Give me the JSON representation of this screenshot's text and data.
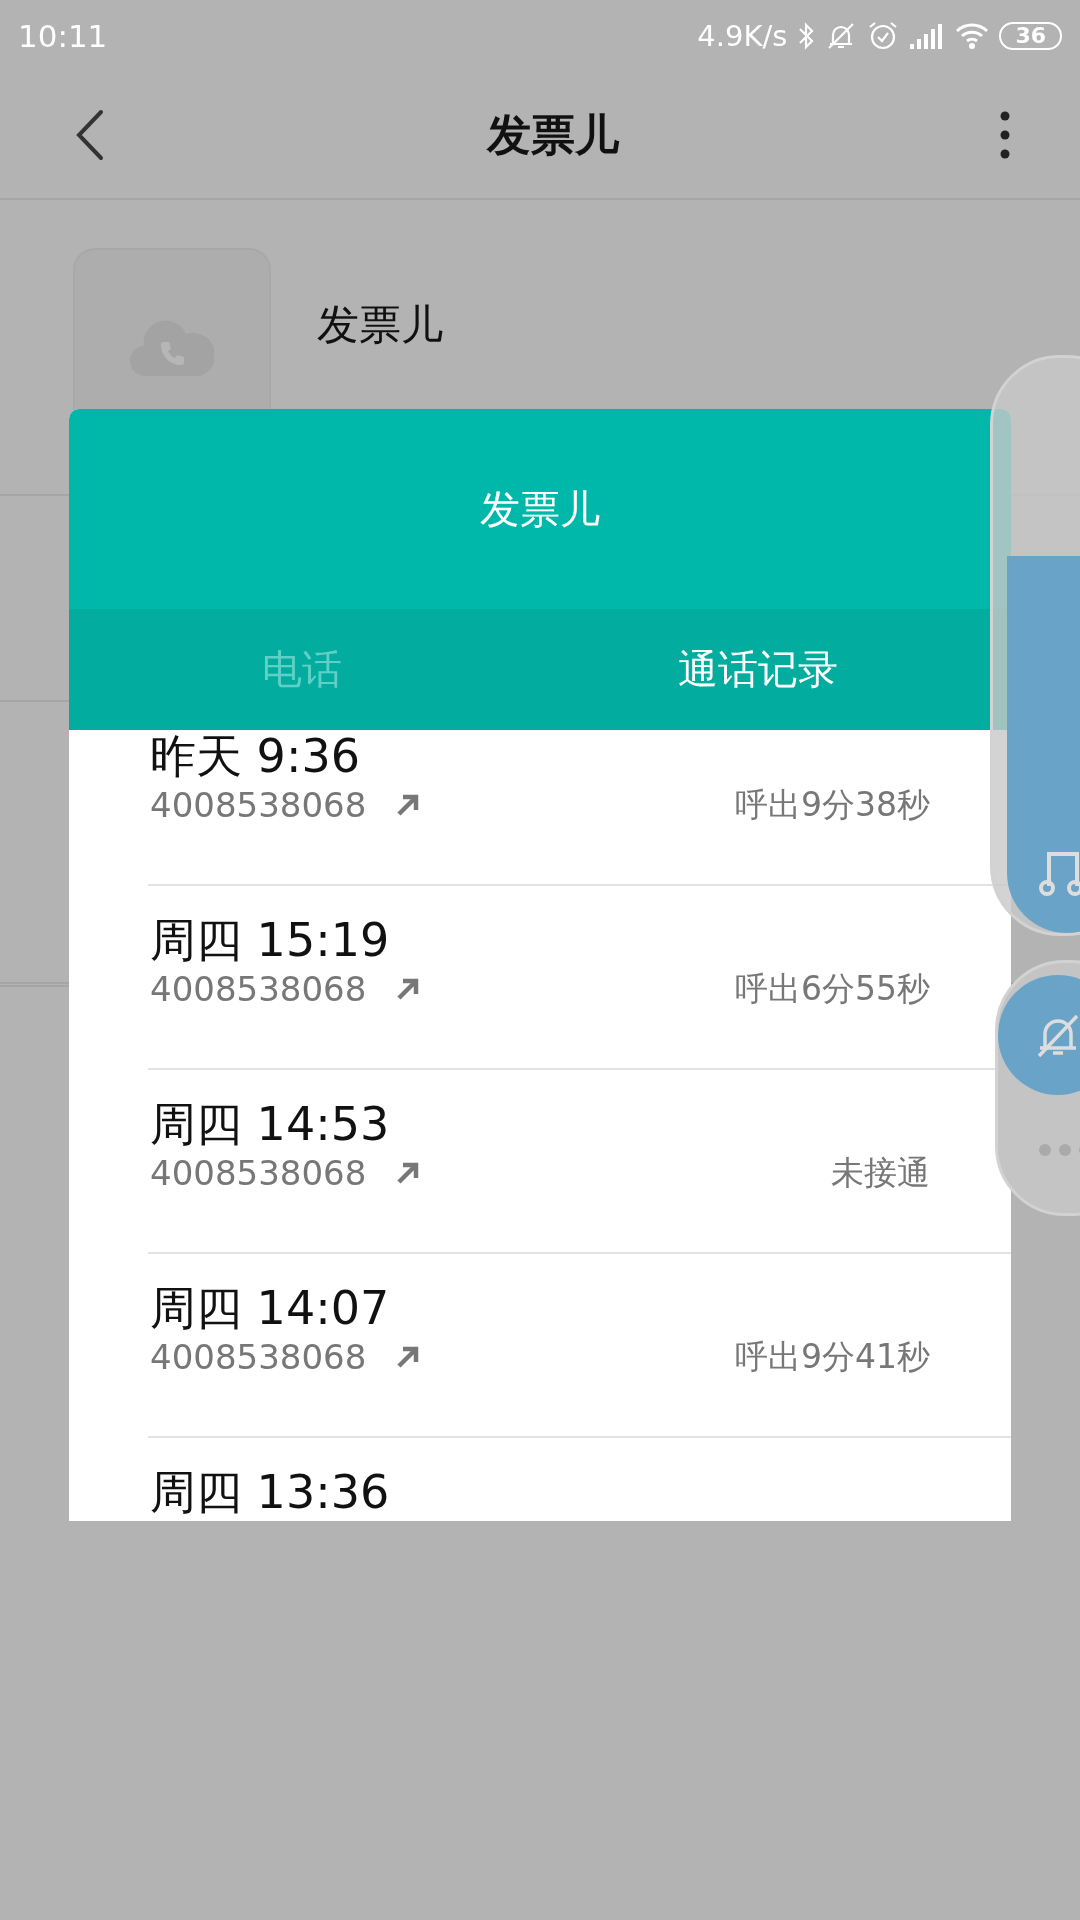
{
  "status_bar": {
    "time": "10:11",
    "net_speed": "4.9K/s",
    "battery": "36"
  },
  "app_bar": {
    "title": "发票儿"
  },
  "contact": {
    "name": "发票儿"
  },
  "dialog": {
    "title": "发票儿",
    "tabs": [
      {
        "label": "电话",
        "selected": false
      },
      {
        "label": "通话记录",
        "selected": true
      }
    ],
    "calls": [
      {
        "time": "昨天 9:36",
        "number": "4008538068",
        "result": "呼出9分38秒"
      },
      {
        "time": "周四 15:19",
        "number": "4008538068",
        "result": "呼出6分55秒"
      },
      {
        "time": "周四 14:53",
        "number": "4008538068",
        "result": "未接通"
      },
      {
        "time": "周四 14:07",
        "number": "4008538068",
        "result": "呼出9分41秒"
      },
      {
        "time": "周四 13:36"
      }
    ]
  }
}
